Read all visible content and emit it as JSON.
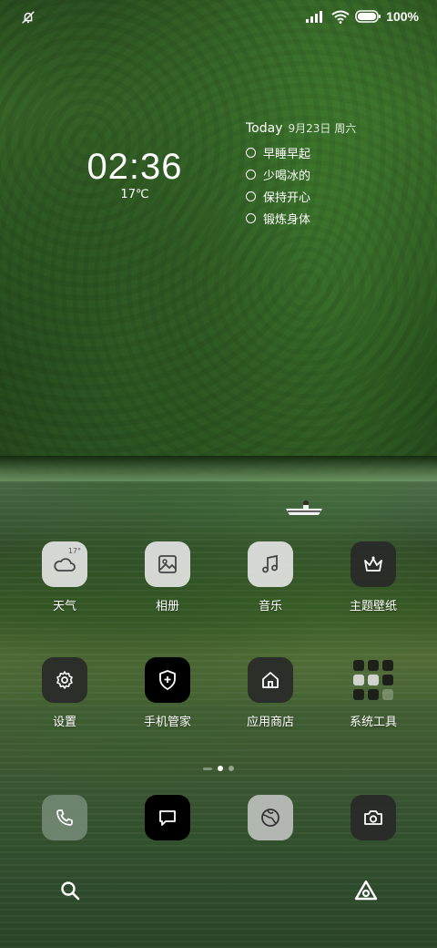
{
  "status_bar": {
    "battery_text": "100%"
  },
  "clock_widget": {
    "time": "02:36",
    "temperature": "17℃"
  },
  "todo_widget": {
    "title": "Today",
    "date": "9月23日 周六",
    "items": [
      "早睡早起",
      "少喝冰的",
      "保持开心",
      "锻炼身体"
    ]
  },
  "apps": {
    "weather": {
      "label": "天气",
      "temp_badge": "17°"
    },
    "gallery": {
      "label": "相册"
    },
    "music": {
      "label": "音乐"
    },
    "themes": {
      "label": "主题壁纸"
    },
    "settings": {
      "label": "设置"
    },
    "security": {
      "label": "手机管家"
    },
    "app_store": {
      "label": "应用商店"
    },
    "system_tools": {
      "label": "系统工具"
    }
  },
  "dock": {
    "icons": [
      "phone-icon",
      "message-icon",
      "browser-icon",
      "camera-icon"
    ]
  },
  "page_indicator": {
    "pages": 2,
    "active": 1
  },
  "colors": {
    "tile_light": "#e6e6e6",
    "tile_dark": "#282828",
    "tile_black": "#000000",
    "text": "#ffffff"
  }
}
